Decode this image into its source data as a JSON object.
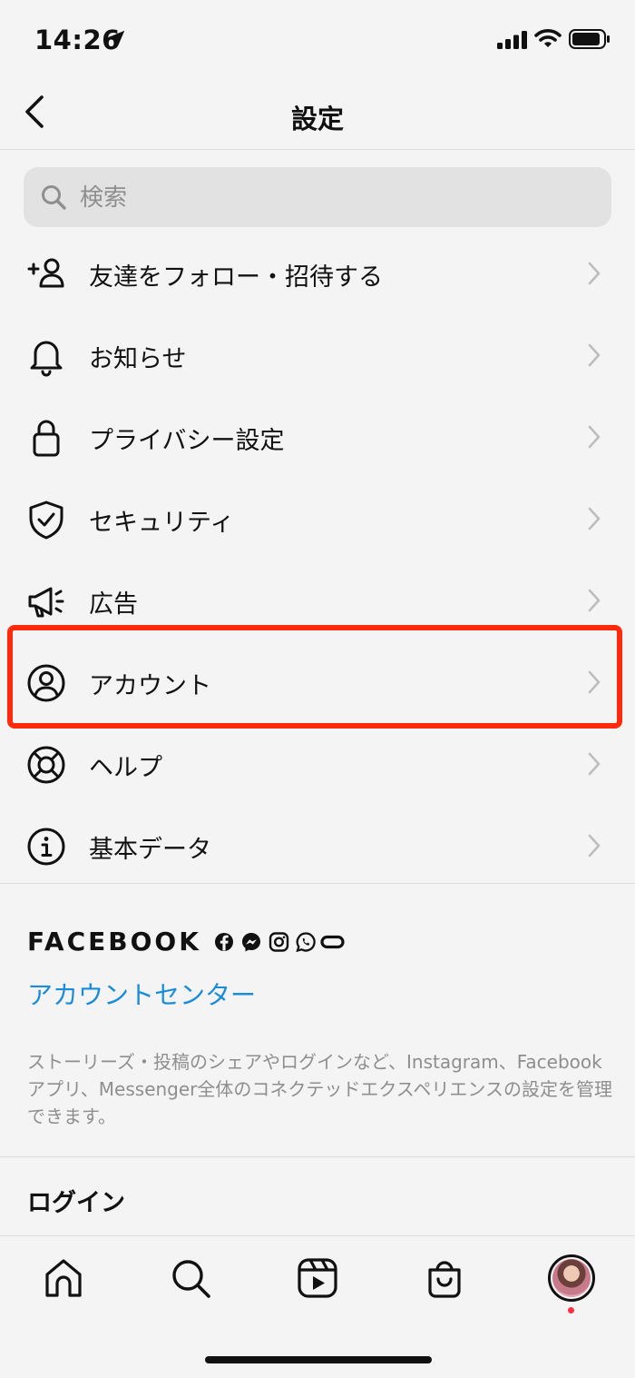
{
  "status_bar": {
    "time": "14:26",
    "icons": [
      "location-arrow-icon",
      "cellular-signal-icon",
      "wifi-icon",
      "battery-icon"
    ]
  },
  "nav": {
    "title": "設定",
    "back_icon": "chevron-left-icon"
  },
  "search": {
    "placeholder": "検索",
    "value": ""
  },
  "menu": {
    "items": [
      {
        "label": "友達をフォロー・招待する",
        "icon": "add-person-icon"
      },
      {
        "label": "お知らせ",
        "icon": "bell-icon"
      },
      {
        "label": "プライバシー設定",
        "icon": "lock-icon"
      },
      {
        "label": "セキュリティ",
        "icon": "shield-check-icon"
      },
      {
        "label": "広告",
        "icon": "megaphone-icon"
      },
      {
        "label": "アカウント",
        "icon": "user-circle-icon",
        "highlighted": true
      },
      {
        "label": "ヘルプ",
        "icon": "lifebuoy-icon"
      },
      {
        "label": "基本データ",
        "icon": "info-icon"
      }
    ]
  },
  "facebook": {
    "brand": "FACEBOOK",
    "icons": [
      "facebook-icon",
      "messenger-icon",
      "instagram-icon",
      "whatsapp-icon",
      "oculus-icon"
    ],
    "account_center_link": "アカウントセンター",
    "description": "ストーリーズ・投稿のシェアやログインなど、Instagram、Facebookアプリ、Messenger全体のコネクテッドエクスペリエンスの設定を管理できます。"
  },
  "login_section": {
    "header": "ログイン"
  },
  "tab_bar": {
    "tabs": [
      "home-icon",
      "search-icon",
      "reels-icon",
      "shop-icon",
      "profile-avatar"
    ]
  },
  "colors": {
    "background": "#f4f4f4",
    "link": "#1a8cd8",
    "highlight_box": "#ff2a0b",
    "secondary_text": "#8e8e8e",
    "notification_dot": "#ff3040"
  }
}
